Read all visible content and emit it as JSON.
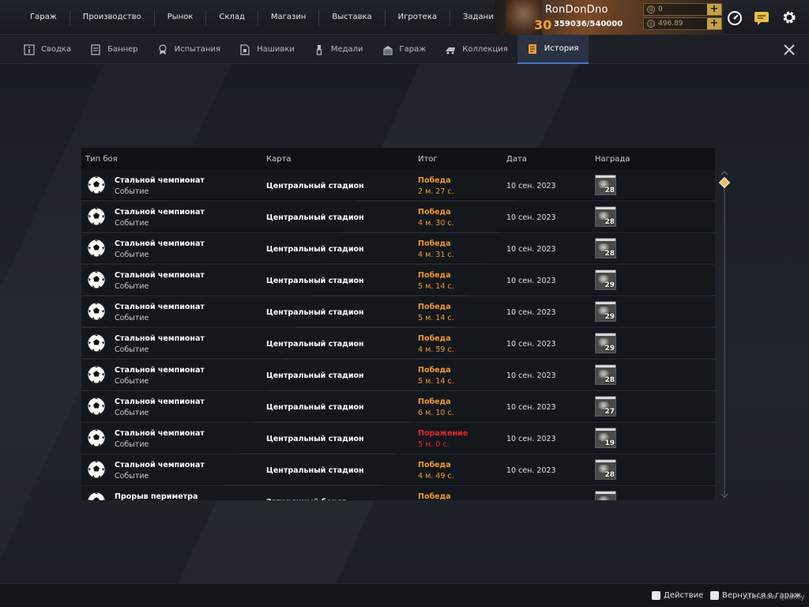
{
  "topnav": {
    "items": [
      "Гараж",
      "Производство",
      "Рынок",
      "Склад",
      "Магазин",
      "Выставка",
      "Игротека",
      "Задания"
    ]
  },
  "profile": {
    "name": "RonDonDno",
    "level": "30",
    "xp": "359036/540000",
    "currency1": "0",
    "currency2": "496.89"
  },
  "tabs": [
    {
      "label": "Сводка",
      "icon": "info-icon"
    },
    {
      "label": "Баннер",
      "icon": "banner-icon"
    },
    {
      "label": "Испытания",
      "icon": "badge-icon"
    },
    {
      "label": "Нашивки",
      "icon": "patch-icon"
    },
    {
      "label": "Медали",
      "icon": "medal-icon"
    },
    {
      "label": "Гараж",
      "icon": "garage-icon"
    },
    {
      "label": "Коллекция",
      "icon": "collection-icon"
    },
    {
      "label": "История",
      "icon": "history-icon",
      "active": true
    }
  ],
  "table": {
    "headers": {
      "type": "Тип боя",
      "map": "Карта",
      "result": "Итог",
      "date": "Дата",
      "reward": "Награда"
    },
    "rows": [
      {
        "title": "Стальной чемпионат",
        "sub": "Событие",
        "map": "Центральный стадион",
        "result": "Победа",
        "time": "2 м. 27 с.",
        "date": "10 сен. 2023",
        "reward": "28"
      },
      {
        "title": "Стальной чемпионат",
        "sub": "Событие",
        "map": "Центральный стадион",
        "result": "Победа",
        "time": "4 м. 30 с.",
        "date": "10 сен. 2023",
        "reward": "28"
      },
      {
        "title": "Стальной чемпионат",
        "sub": "Событие",
        "map": "Центральный стадион",
        "result": "Победа",
        "time": "4 м. 31 с.",
        "date": "10 сен. 2023",
        "reward": "28"
      },
      {
        "title": "Стальной чемпионат",
        "sub": "Событие",
        "map": "Центральный стадион",
        "result": "Победа",
        "time": "5 м. 14 с.",
        "date": "10 сен. 2023",
        "reward": "29"
      },
      {
        "title": "Стальной чемпионат",
        "sub": "Событие",
        "map": "Центральный стадион",
        "result": "Победа",
        "time": "5 м. 14 с.",
        "date": "10 сен. 2023",
        "reward": "29"
      },
      {
        "title": "Стальной чемпионат",
        "sub": "Событие",
        "map": "Центральный стадион",
        "result": "Победа",
        "time": "4 м. 59 с.",
        "date": "10 сен. 2023",
        "reward": "29"
      },
      {
        "title": "Стальной чемпионат",
        "sub": "Событие",
        "map": "Центральный стадион",
        "result": "Победа",
        "time": "5 м. 14 с.",
        "date": "10 сен. 2023",
        "reward": "28"
      },
      {
        "title": "Стальной чемпионат",
        "sub": "Событие",
        "map": "Центральный стадион",
        "result": "Победа",
        "time": "6 м. 10 с.",
        "date": "10 сен. 2023",
        "reward": "27"
      },
      {
        "title": "Стальной чемпионат",
        "sub": "Событие",
        "map": "Центральный стадион",
        "result": "Поражение",
        "time": "5 м. 0 с.",
        "date": "10 сен. 2023",
        "reward": "19",
        "loss": true
      },
      {
        "title": "Стальной чемпионат",
        "sub": "Событие",
        "map": "Центральный стадион",
        "result": "Победа",
        "time": "4 м. 49 с.",
        "date": "10 сен. 2023",
        "reward": "28"
      },
      {
        "title": "Прорыв периметра",
        "sub": "",
        "map": "Затерянный берег",
        "result": "Победа",
        "time": "",
        "date": "",
        "reward": ""
      }
    ]
  },
  "bottombar": {
    "action": "Действие",
    "back": "Вернуться в гараж"
  },
  "quality": "Ultralow quality",
  "colors": {
    "win": "#f09a2a",
    "loss": "#e82828",
    "accent": "#4a78c8"
  }
}
